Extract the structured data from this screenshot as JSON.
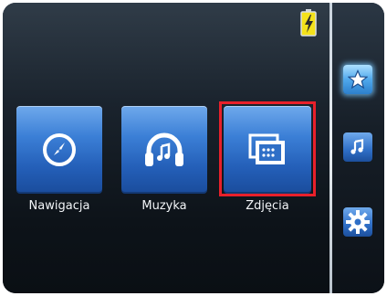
{
  "status": {
    "battery_icon": "battery-charging-icon"
  },
  "main_menu": {
    "items": [
      {
        "label": "Nawigacja",
        "icon": "compass-icon"
      },
      {
        "label": "Muzyka",
        "icon": "headphones-icon"
      },
      {
        "label": "Zdjęcia",
        "icon": "photos-icon"
      }
    ],
    "selected": "Zdjęcia"
  },
  "side_menu": {
    "items": [
      {
        "icon": "star-icon"
      },
      {
        "icon": "music-note-icon"
      },
      {
        "icon": "gear-icon"
      }
    ]
  },
  "colors": {
    "tile_blue": "#2f6fc7",
    "selection_red": "#e8202b",
    "battery_yellow": "#f4e21a"
  }
}
